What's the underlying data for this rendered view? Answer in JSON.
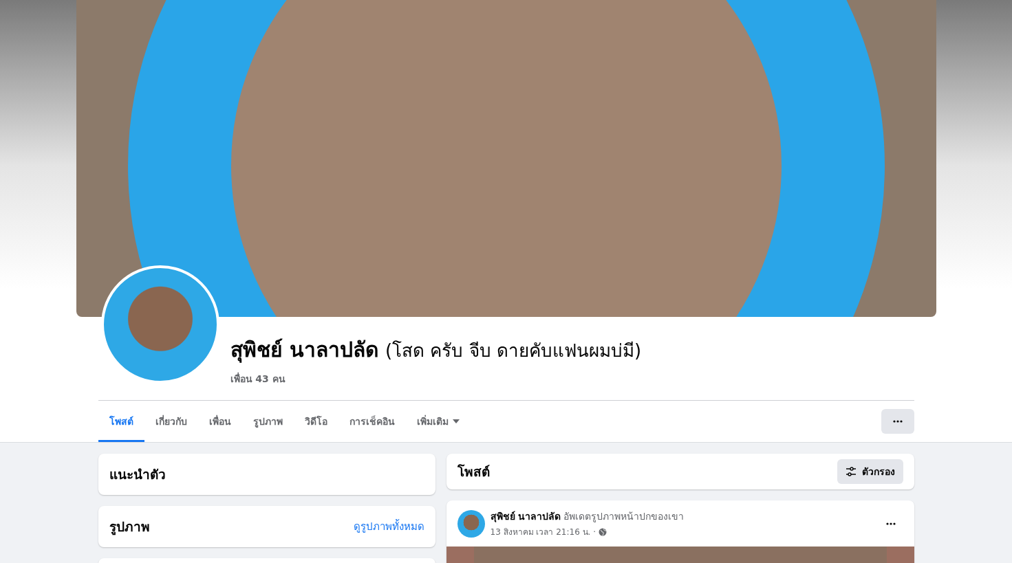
{
  "profile": {
    "name": "สุพิชย์ นาลาปลัด",
    "nickname": "(โสด ครับ จีบ ดายคับแฟนผมบ่มี)",
    "friends": "เพื่อน 43 คน"
  },
  "tabs": [
    {
      "label": "โพสต์",
      "selected": true,
      "kind": "link"
    },
    {
      "label": "เกี่ยวกับ",
      "selected": false,
      "kind": "link"
    },
    {
      "label": "เพื่อน",
      "selected": false,
      "kind": "link"
    },
    {
      "label": "รูปภาพ",
      "selected": false,
      "kind": "link"
    },
    {
      "label": "วิดีโอ",
      "selected": false,
      "kind": "link"
    },
    {
      "label": "การเช็คอิน",
      "selected": false,
      "kind": "link"
    },
    {
      "label": "เพิ่มเติม",
      "selected": false,
      "kind": "menu"
    }
  ],
  "intro_card": {
    "title": "แนะนำตัว"
  },
  "photos_card": {
    "title": "รูปภาพ",
    "link": "ดูรูปภาพทั้งหมด"
  },
  "posts_header": {
    "title": "โพสต์",
    "filter_button": "ตัวกรอง"
  },
  "post": {
    "author": "สุพิชย์ นาลาปลัด",
    "action": "อัพเดตรูปภาพหน้าปกของเขา",
    "time": "13 สิงหาคม เวลา 21:16 น. ·"
  }
}
